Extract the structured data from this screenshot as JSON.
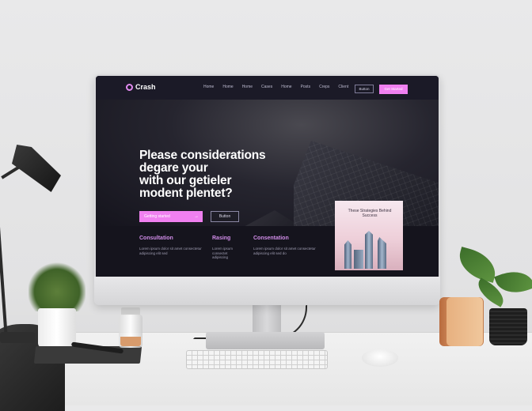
{
  "site": {
    "logo_text": "Crash",
    "nav_links": [
      "Home",
      "Home",
      "Home",
      "Cases",
      "Home",
      "Posts",
      "Creps",
      "Client"
    ],
    "nav_outline_button": "Button",
    "nav_cta_button": "Get Started",
    "hero": {
      "title_lines": [
        "Please considerations",
        "degare your",
        "with our getieler",
        "modent plentet?"
      ],
      "primary_button": "Getting started",
      "primary_arrow": "→",
      "secondary_button": "Button"
    },
    "features": [
      {
        "title": "Consultation",
        "text": "Lorem ipsum dolor sit amet consectetur adipiscing elit sed"
      },
      {
        "title": "Rasing",
        "text": "Lorem ipsum consectet adipiscing"
      },
      {
        "title": "Consentation",
        "text": "Lorem ipsum dolor sit amet consectetur adipiscing elit sed do"
      }
    ],
    "card_text": "These Strategies Behind Success"
  },
  "colors": {
    "accent": "#f080f0",
    "feature_title": "#d08ce8",
    "screen_bg": "#141320"
  }
}
